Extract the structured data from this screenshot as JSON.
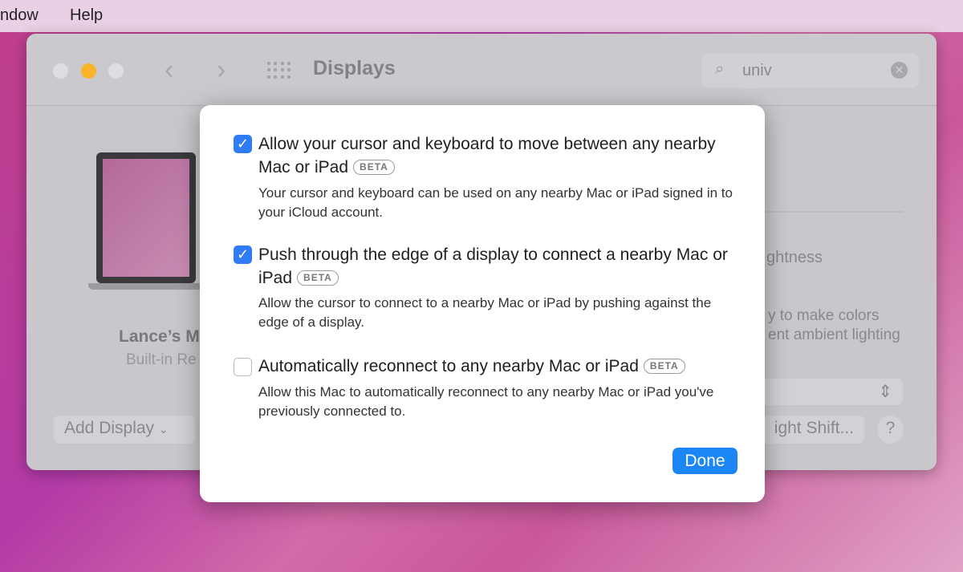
{
  "menubar": {
    "items": [
      "ndow",
      "Help"
    ]
  },
  "window": {
    "title": "Displays",
    "search_value": "univ",
    "display_name": "Lance’s M",
    "display_type": "Built-in Re",
    "add_display": "Add Display",
    "brightness": "ghtness",
    "truetone_line1": "y to make colors",
    "truetone_line2": "ent ambient lighting",
    "night_shift": "ight Shift...",
    "help": "?"
  },
  "dialog": {
    "options": [
      {
        "label": "Allow your cursor and keyboard to move between any nearby Mac or iPad",
        "badge": "BETA",
        "checked": true,
        "description": "Your cursor and keyboard can be used on any nearby Mac or iPad signed in to your iCloud account."
      },
      {
        "label": "Push through the edge of a display to connect a nearby Mac or iPad",
        "badge": "BETA",
        "checked": true,
        "description": "Allow the cursor to connect to a nearby Mac or iPad by pushing against the edge of a display."
      },
      {
        "label": "Automatically reconnect to any nearby Mac or iPad",
        "badge": "BETA",
        "checked": false,
        "description": "Allow this Mac to automatically reconnect to any nearby Mac or iPad you've previously connected to."
      }
    ],
    "done": "Done"
  },
  "colors": {
    "accent": "#1c86f7",
    "close_light": "#dedde0",
    "minimize_light": "#f9b52a"
  }
}
